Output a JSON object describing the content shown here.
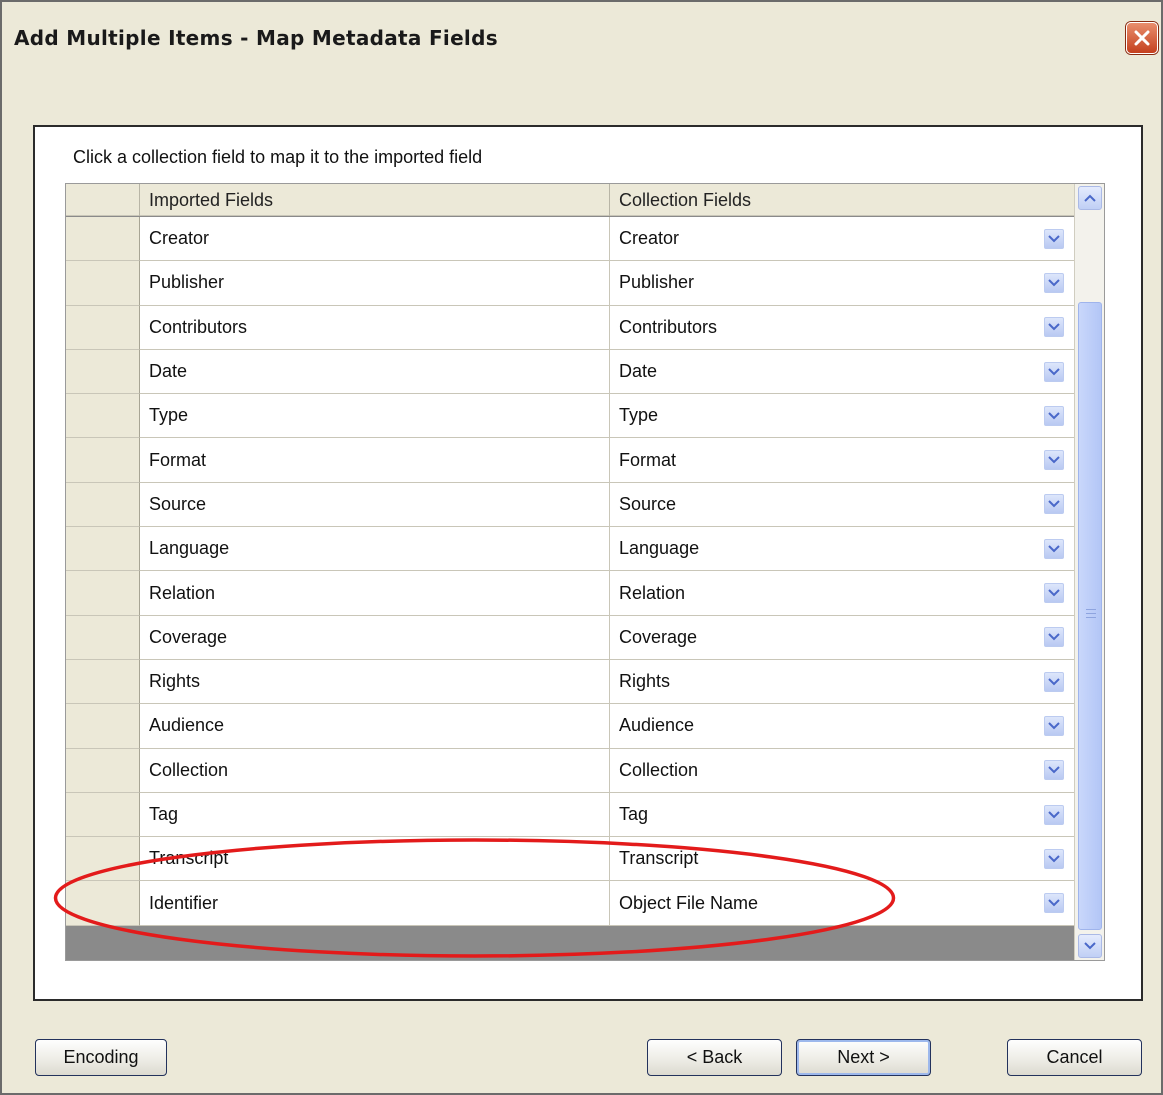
{
  "window": {
    "title": "Add Multiple Items - Map Metadata Fields",
    "close_icon": "close-icon"
  },
  "instruction": "Click a collection field to map it to the imported field",
  "grid": {
    "headers": {
      "imported": "Imported Fields",
      "collection": "Collection Fields"
    },
    "rows": [
      {
        "imported": "Creator",
        "collection": "Creator"
      },
      {
        "imported": "Publisher",
        "collection": "Publisher"
      },
      {
        "imported": "Contributors",
        "collection": "Contributors"
      },
      {
        "imported": "Date",
        "collection": "Date"
      },
      {
        "imported": "Type",
        "collection": "Type"
      },
      {
        "imported": "Format",
        "collection": "Format"
      },
      {
        "imported": "Source",
        "collection": "Source"
      },
      {
        "imported": "Language",
        "collection": "Language"
      },
      {
        "imported": "Relation",
        "collection": "Relation"
      },
      {
        "imported": "Coverage",
        "collection": "Coverage"
      },
      {
        "imported": "Rights",
        "collection": "Rights"
      },
      {
        "imported": "Audience",
        "collection": "Audience"
      },
      {
        "imported": "Collection",
        "collection": "Collection"
      },
      {
        "imported": "Tag",
        "collection": "Tag"
      },
      {
        "imported": "Transcript",
        "collection": "Transcript"
      },
      {
        "imported": "Identifier",
        "collection": "Object File Name"
      }
    ]
  },
  "buttons": {
    "encoding": "Encoding",
    "back": "< Back",
    "next": "Next >",
    "cancel": "Cancel"
  },
  "colors": {
    "window_bg": "#ece9d8",
    "highlight": "#e31b1b",
    "dropdown_accent": "#4a68c9"
  }
}
